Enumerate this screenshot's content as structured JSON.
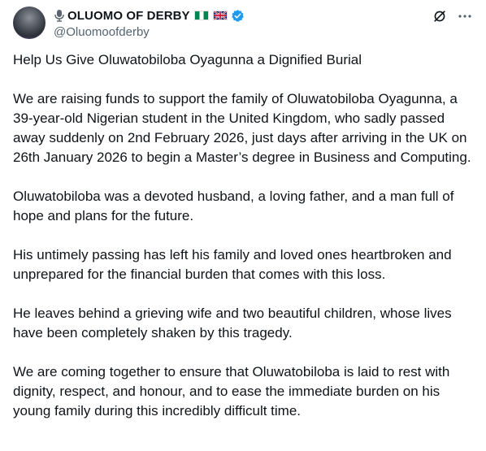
{
  "author": {
    "display_name": "OLUOMO OF DERBY",
    "handle": "@Oluomoofderby",
    "badges": [
      "microphone-icon",
      "nigeria-flag",
      "uk-flag",
      "verified-badge"
    ],
    "verified_color": "#1d9bf0"
  },
  "post": {
    "paragraphs": [
      "Help Us Give Oluwatobiloba Oyagunna a Dignified Burial",
      "We are raising funds to support the family of Oluwatobiloba Oyagunna, a 39-year-old Nigerian student in the United Kingdom, who sadly passed away suddenly on 2nd February 2026, just days after arriving in the UK on 26th January 2026 to begin a Master’s degree in Business and Computing.",
      "Oluwatobiloba was a devoted husband, a loving father, and a man full of hope and plans for the future.",
      "His untimely passing has left his family and loved ones heartbroken and unprepared for the financial burden that comes with this loss.",
      "He leaves behind a grieving wife and two beautiful children, whose lives have been completely shaken by this tragedy.",
      "We are coming together to ensure that Oluwatobiloba is laid to rest with dignity, respect, and honour, and to ease the immediate burden on his young family during this incredibly difficult time."
    ]
  },
  "actions": {
    "icons": [
      "grok-icon",
      "more-options-icon"
    ]
  }
}
